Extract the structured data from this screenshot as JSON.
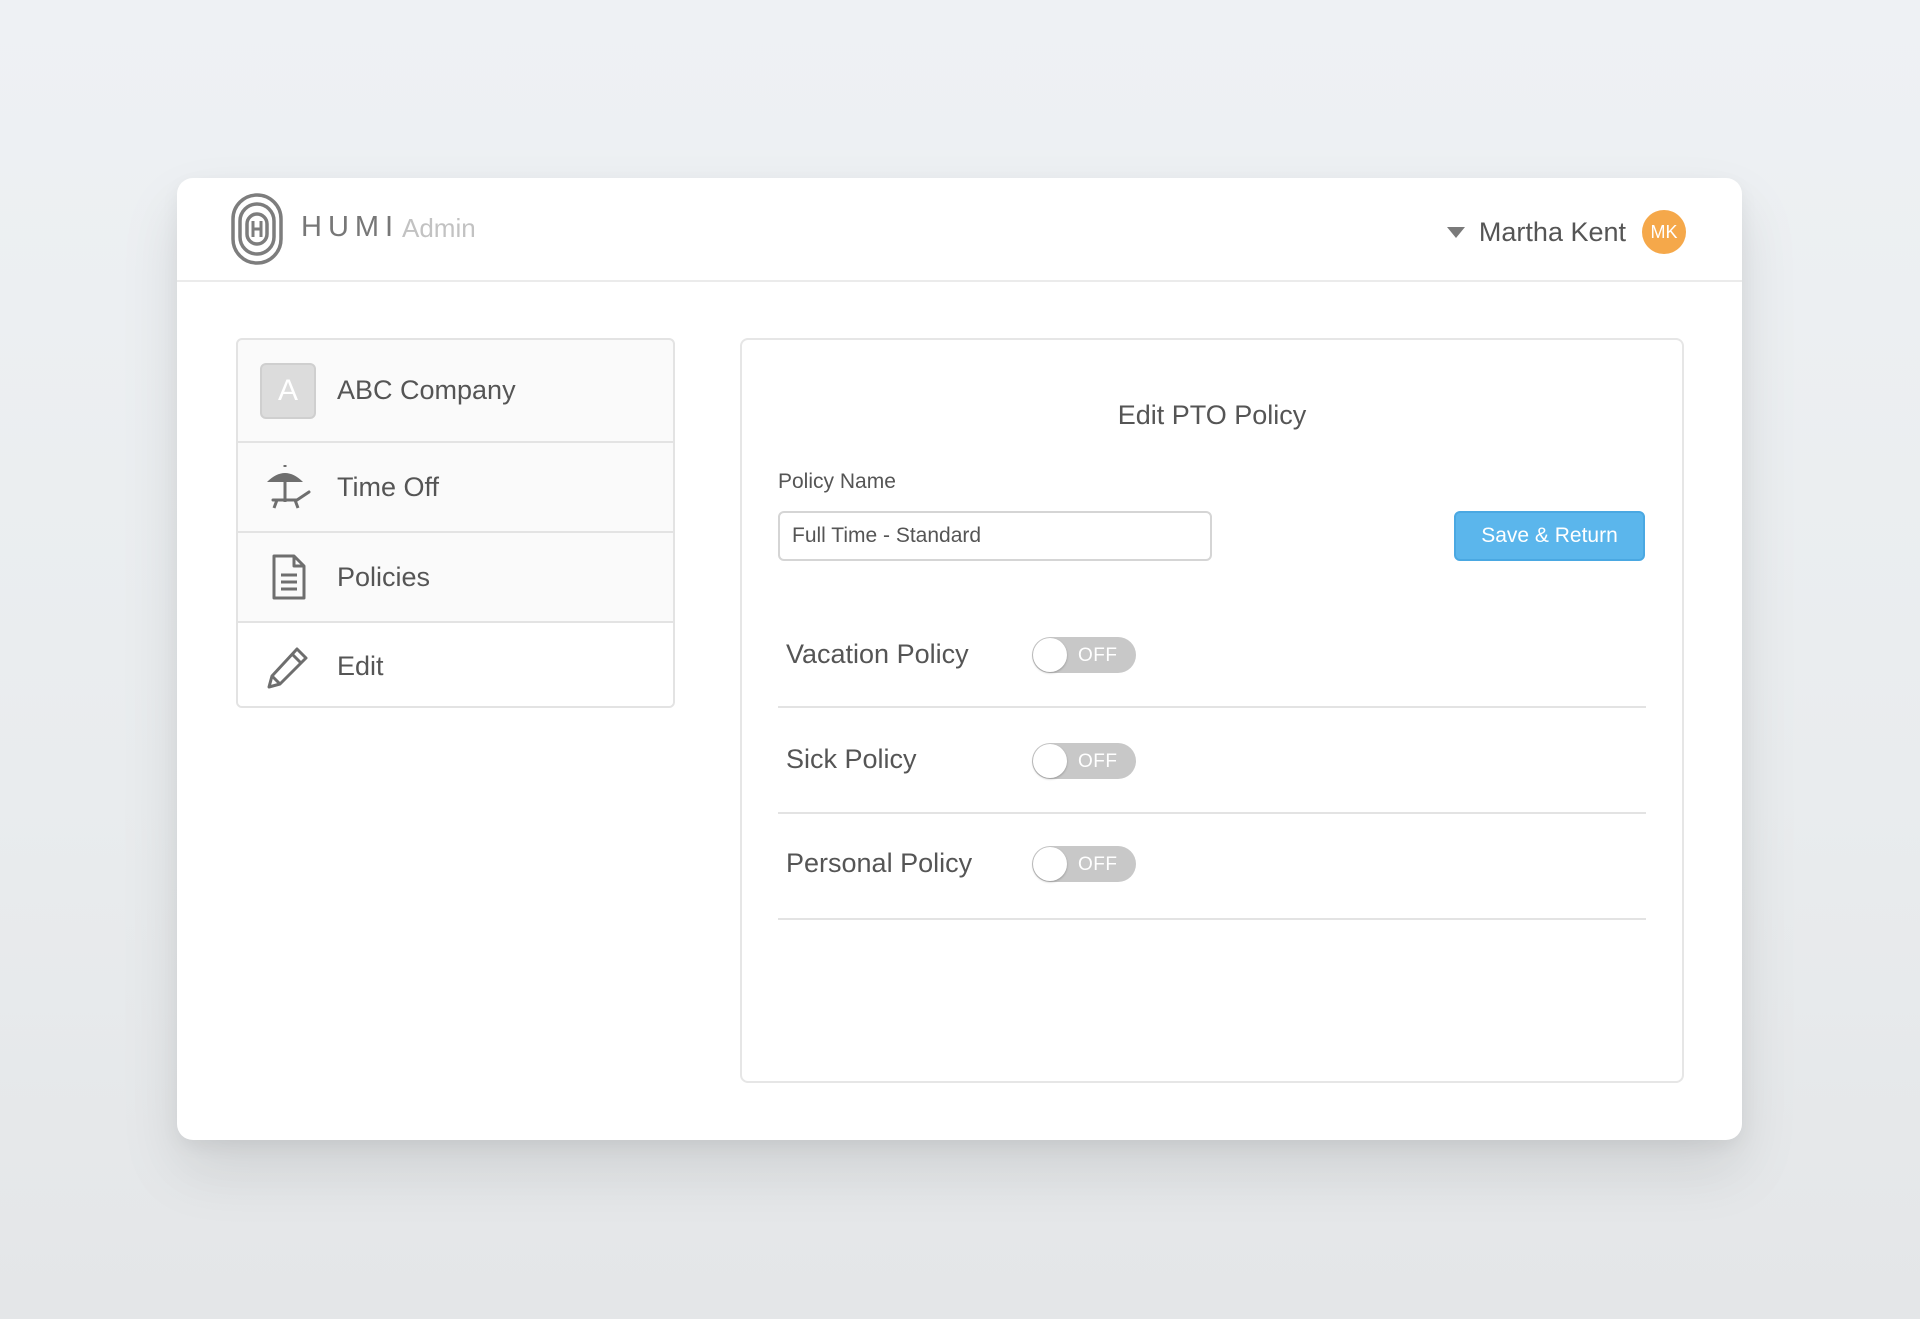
{
  "header": {
    "brand": "HUMI",
    "brand_sub": "Admin",
    "user_name": "Martha Kent",
    "user_initials": "MK"
  },
  "sidebar": {
    "items": [
      {
        "label": "ABC Company",
        "icon": "company-initial-badge",
        "badge_letter": "A"
      },
      {
        "label": "Time Off",
        "icon": "beach-umbrella-icon"
      },
      {
        "label": "Policies",
        "icon": "document-icon"
      },
      {
        "label": "Edit",
        "icon": "pencil-icon"
      }
    ]
  },
  "main": {
    "title": "Edit PTO Policy",
    "policy_name_label": "Policy Name",
    "policy_name_value": "Full Time - Standard",
    "save_label": "Save & Return",
    "policies": [
      {
        "label": "Vacation Policy",
        "toggle_text": "OFF",
        "enabled": false
      },
      {
        "label": "Sick Policy",
        "toggle_text": "OFF",
        "enabled": false
      },
      {
        "label": "Personal Policy",
        "toggle_text": "OFF",
        "enabled": false
      }
    ]
  },
  "colors": {
    "accent": "#5bb6ec",
    "avatar": "#f5a84a",
    "toggle_off": "#c8c8c8"
  }
}
